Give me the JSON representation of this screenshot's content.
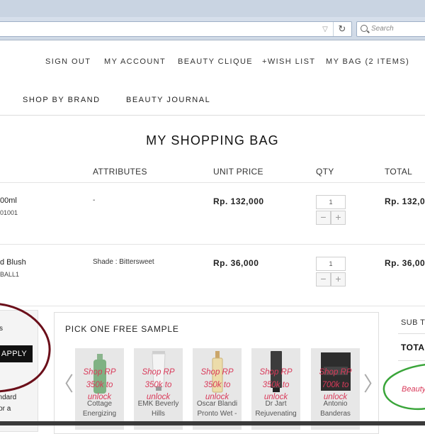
{
  "browser": {
    "search_placeholder": "Search",
    "reload_glyph": "↻",
    "dropdown_glyph": "▽"
  },
  "topnav": {
    "sign_out": "SIGN OUT",
    "my_account": "MY ACCOUNT",
    "beauty_clique": "BEAUTY CLIQUE",
    "wish_list": "+WISH LIST",
    "my_bag": "MY BAG (2 ITEMS)"
  },
  "mainnav": {
    "shop_by_brand": "SHOP BY BRAND",
    "beauty_journal": "BEAUTY JOURNAL"
  },
  "page_title": "MY SHOPPING BAG",
  "table": {
    "headers": {
      "attributes": "ATTRIBUTES",
      "unit_price": "UNIT PRICE",
      "qty": "QTY",
      "total": "TOTAL"
    },
    "rows": [
      {
        "name": "00ml",
        "code": "01001",
        "attributes": "-",
        "unit_price": "Rp. 132,000",
        "qty": "1",
        "total": "Rp. 132,0"
      },
      {
        "name": "d Blush",
        "code": "BALL1",
        "attributes": "Shade : Bittersweet",
        "unit_price": "Rp. 36,000",
        "qty": "1",
        "total": "Rp. 36,00"
      }
    ],
    "minus_glyph": "−",
    "plus_glyph": "+"
  },
  "promo": {
    "label": "s",
    "apply": "APPLY",
    "line1": "andard",
    "line2": "For a"
  },
  "samples": {
    "title": "PICK ONE FREE SAMPLE",
    "prev_glyph": "〈",
    "next_glyph": "〉",
    "items": [
      {
        "unlock": [
          "Shop RP",
          "350k to",
          "unlock"
        ],
        "name": [
          "Cottage",
          "Energizing"
        ]
      },
      {
        "unlock": [
          "Shop RP",
          "350k to",
          "unlock"
        ],
        "name": [
          "EMK Beverly",
          "Hills"
        ]
      },
      {
        "unlock": [
          "Shop RP",
          "350k to",
          "unlock"
        ],
        "name": [
          "Oscar Blandi",
          "Pronto Wet -"
        ]
      },
      {
        "unlock": [
          "Shop RP",
          "350k to",
          "unlock"
        ],
        "name": [
          "Dr Jart",
          "Rejuvenating"
        ]
      },
      {
        "unlock": [
          "Shop RP",
          "700k to",
          "unlock"
        ],
        "name": [
          "Antonio",
          "Banderas"
        ]
      }
    ]
  },
  "summary": {
    "subtotal": "SUB TO",
    "total": "TOTA",
    "link": "Beauty"
  },
  "colors": {
    "accent_pink": "#d93a5a",
    "annotation_red": "#6b0f1a",
    "annotation_green": "#3aa53a"
  }
}
